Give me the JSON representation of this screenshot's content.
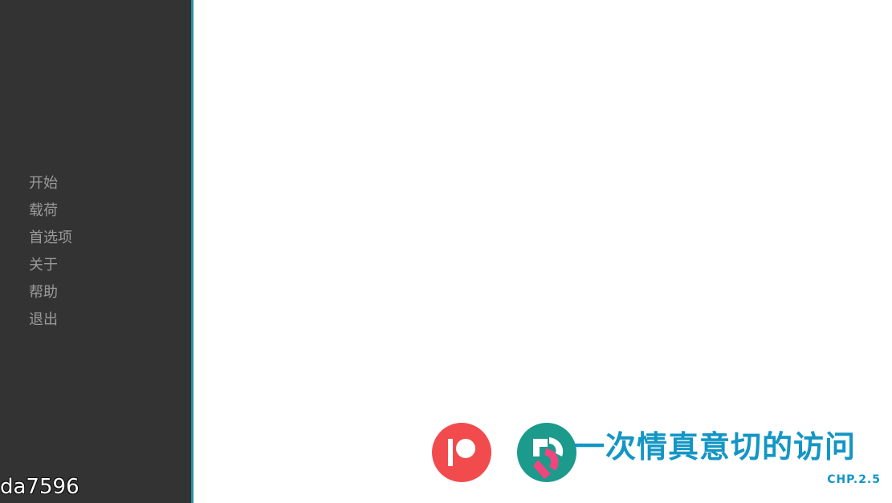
{
  "menu": {
    "items": [
      {
        "label": "开始"
      },
      {
        "label": "载荷"
      },
      {
        "label": "首选项"
      },
      {
        "label": "关于"
      },
      {
        "label": "帮助"
      },
      {
        "label": "退出"
      }
    ]
  },
  "overlay": {
    "version_text": "da7596"
  },
  "branding": {
    "title": "一次情真意切的访问",
    "chapter": "CHP.2.5",
    "colors": {
      "sidebar_bg": "#333333",
      "sidebar_border": "#2a8fa0",
      "menu_text": "#9a9a9a",
      "title_blue": "#1496c4",
      "patreon_red": "#f14b4e",
      "logo_teal": "#1c9a8c",
      "logo_pink": "#f0457e"
    },
    "icons": [
      "patreon-icon",
      "game-logo-icon"
    ]
  }
}
